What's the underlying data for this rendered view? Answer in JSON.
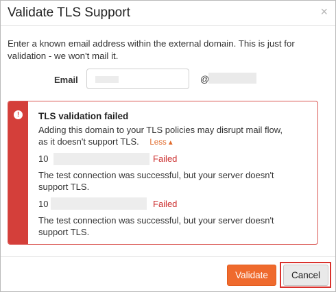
{
  "dialog": {
    "title": "Validate TLS Support",
    "close_glyph": "×",
    "intro": "Enter a known email address within the external domain. This is just for validation - we won't mail it."
  },
  "email": {
    "label": "Email",
    "value": "",
    "at": "@"
  },
  "alert": {
    "icon": "alert-exclamation-icon",
    "icon_glyph": "!",
    "title": "TLS validation failed",
    "message": "Adding this domain to your TLS policies may disrupt mail flow, as it doesn't support TLS.",
    "toggle_label": "Less",
    "toggle_glyph": "▴",
    "results": [
      {
        "prefix": "10",
        "status": "Failed",
        "detail": "The test connection was successful, but your server doesn't support TLS."
      },
      {
        "prefix": "10",
        "status": "Failed",
        "detail": "The test connection was successful, but your server doesn't support TLS."
      }
    ]
  },
  "footer": {
    "validate_label": "Validate",
    "cancel_label": "Cancel"
  },
  "colors": {
    "accent": "#ef6a2d",
    "error": "#d43f3a",
    "failed_text": "#cc2d2d",
    "highlight": "#d9312c"
  }
}
